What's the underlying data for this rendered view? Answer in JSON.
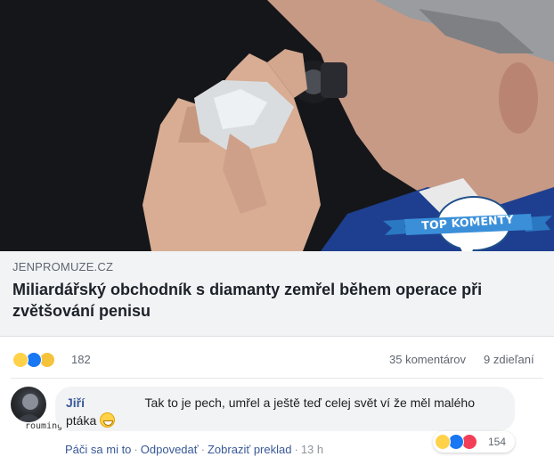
{
  "photo": {
    "badge_text": "TOP KOMENTY"
  },
  "link_preview": {
    "domain": "JENPROMUZE.CZ",
    "headline": "Miliardářský obchodník s diamanty zemřel během operace při zvětšování penisu"
  },
  "post_stats": {
    "reaction_icons": [
      "haha-emoji",
      "like-emoji",
      "sad-emoji"
    ],
    "reaction_count": "182",
    "comments": "35 komentárov",
    "shares": "9 zdieľaní"
  },
  "comment": {
    "author": "Jiří",
    "text": "Tak to je pech, umřel a ještě teď celej svět ví že měl malého ptáka",
    "watermark": "roumingcz",
    "actions": {
      "like": "Páči sa mi to",
      "reply": "Odpovedať",
      "translate": "Zobraziť preklad",
      "time": "13 h"
    },
    "reactions": {
      "icons": [
        "haha-emoji",
        "like-emoji",
        "love-emoji"
      ],
      "count": "154"
    }
  },
  "colors": {
    "link_blue": "#385898",
    "badge_blue": "#2b78c2",
    "preview_bg": "#f2f3f5"
  }
}
